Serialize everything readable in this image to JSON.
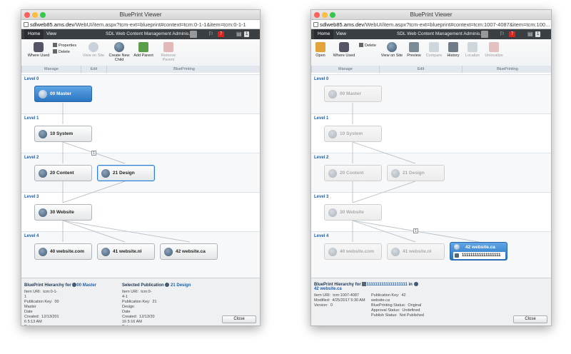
{
  "left": {
    "window_title": "BluePrint Viewer",
    "url_host": "sdlweb85.ams.dev",
    "url_path": "/WebUI/item.aspx?tcm-ext=blueprint#context=tcm:0-1-1&item=tcm:0-1-1",
    "tabs": {
      "home": "Home",
      "view": "View"
    },
    "app_title": "SDL Web Content Management Adminis...",
    "notif_count": "7",
    "page_count": "1",
    "ribbon": {
      "where_used": "Where Used",
      "properties": "Properties",
      "delete": "Delete",
      "view_on_site": "View on Site",
      "create_new_child": "Create New Child",
      "add_parent": "Add Parent",
      "remove_parent": "Remove Parent",
      "groups": {
        "manage": "Manage",
        "edit": "Edit",
        "blueprinting": "BluePrinting"
      }
    },
    "levels": [
      "Level 0",
      "Level 1",
      "Level 2",
      "Level 3",
      "Level 4"
    ],
    "nodes": {
      "master": "00 Master",
      "system": "10 System",
      "content": "20 Content",
      "design": "21 Design",
      "website": "30 Website",
      "com": "40 website.com",
      "nl": "41 website.nl",
      "ca": "42 website.ca"
    },
    "hint": "1",
    "footer": {
      "hierarchy_for": "BluePrint Hierarchy for",
      "hierarchy_item": "00 Master",
      "selected_pub": "Selected Publication",
      "selected_item": "21 Design",
      "col1": "Item URI:  tcm:0-1-\n1\nPublication Key:  00\nMaster\nDate\nCreated:  12/13/201\n6 5:13 AM\nDate",
      "col2": "Item URI:  tcm:0-\n4-1\nPublication Key:  21\nDesign\nDate\nCreated:  12/13/20\n16 5:16 AM\nDate",
      "close": "Close"
    }
  },
  "right": {
    "window_title": "BluePrint Viewer",
    "url_host": "sdlweb85.ams.dev",
    "url_path": "/WebUI/item.aspx?tcm-ext=blueprint#context=tcm:1007-4087&item=tcm:100...",
    "tabs": {
      "home": "Home",
      "view": "View"
    },
    "app_title": "SDL Web Content Management Adminis...",
    "notif_count": "7",
    "page_count": "1",
    "ribbon": {
      "open": "Open",
      "where_used": "Where Used",
      "delete": "Delete",
      "view_on_site": "View on Site",
      "preview": "Preview",
      "compare": "Compare",
      "history": "History",
      "localize": "Localize",
      "unlocalize": "Unlocalize",
      "groups": {
        "manage": "Manage",
        "edit": "Edit",
        "blueprinting": "BluePrinting"
      }
    },
    "levels": [
      "Level 0",
      "Level 1",
      "Level 2",
      "Level 3",
      "Level 4"
    ],
    "nodes": {
      "master": "00 Master",
      "system": "10 System",
      "content": "20 Content",
      "design": "21 Design",
      "website": "30 Website",
      "com": "40 website.com",
      "nl": "41 website.nl",
      "ca": "42 website.ca",
      "ca_item": "111111111111111111"
    },
    "hint": "1",
    "footer": {
      "hierarchy_for": "BluePrint Hierarchy for",
      "hierarchy_item": "1111111111111111111",
      "in_word": "in",
      "context": "42 website.ca",
      "col1": "Item URI:  tcm:1007-4087\nModified:  4/25/2017 5:30 AM\nVersion:  0",
      "col2": "Publication Key:  42\nwebsite.ca\nBluePrinting Status:  Original\nApproval Status:  Undefined\nPublish Status:  Not Published",
      "close": "Close"
    }
  }
}
